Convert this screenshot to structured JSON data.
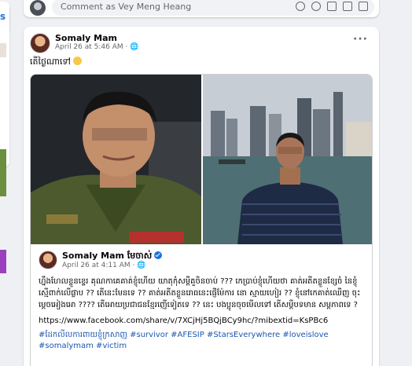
{
  "comment_bar": {
    "placeholder": "Comment as Vey Meng Heang",
    "icons": [
      "sticker-icon",
      "emoji-icon",
      "camera-icon",
      "gif-icon",
      "sticker-square-icon"
    ]
  },
  "post": {
    "author": "Somaly Mam",
    "meta": "April 26 at 5:46 AM · 🌐",
    "text": "តើថ្ងៃណាទៅ",
    "shared": {
      "author": "Somaly Mam មែចាស់",
      "meta": "April 26 at 4:11 AM · 🌐",
      "body": "ហ្នឹងហែលខ្លួនខ្ទេរ គុណកាគេគាត់ខ្ញុំហើយ យាតុកុំសម្ដីគួចិនចាប់ ??? កេប្រាប់ខ្ញុំហើយថា គាត់អតីតខ្លួនខ្សែចំ នៃខ្ញុំស្មើពាក់លើផ្លាប ?? តើនេះមែនទេ ?? គាត់អតីតខ្លួនរោធនេះផ្ញើម៉ែការ នោ ស្មាយហៀរ ?? ខ្ញុំនៅកេគាត់ឈើញ ចុះម្ដេចអៀងអោ ???? តើអោយប្រជាជនខ្មែរញើទៀតទេ ?? នេះ បងប្អូនចុចមើលទៅ តើសម្ដីបទមាន សម្ដភាពទេ ?",
      "link": "https://www.facebook.com/share/v/7XCjHj5BQjBCy9hc/?mibextid=KsPBc6",
      "tags": "#ដែកលីលការពាយខ្ញុំក្រសាញ #survivor #AFESIP #StarsEverywhere #loveislove #somalymam #victim"
    }
  },
  "colors": {
    "accent": "#1b74e4",
    "hashtag": "#1b56b0",
    "background": "#eef0f3"
  }
}
